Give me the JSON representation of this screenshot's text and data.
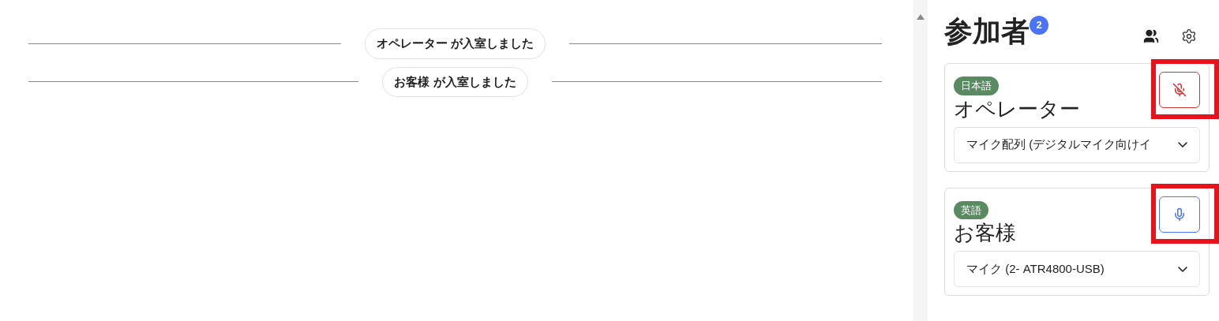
{
  "messages": [
    {
      "text": "オペレーター が入室しました"
    },
    {
      "text": "お客様 が入室しました"
    }
  ],
  "panel": {
    "title": "参加者",
    "count": "2"
  },
  "participants": [
    {
      "language": "日本語",
      "name": "オペレーター",
      "device": "マイク配列 (デジタルマイク向けイ",
      "muted": true,
      "highlighted": true
    },
    {
      "language": "英語",
      "name": "お客様",
      "device": "マイク (2- ATR4800-USB)",
      "muted": false,
      "highlighted": true
    }
  ]
}
